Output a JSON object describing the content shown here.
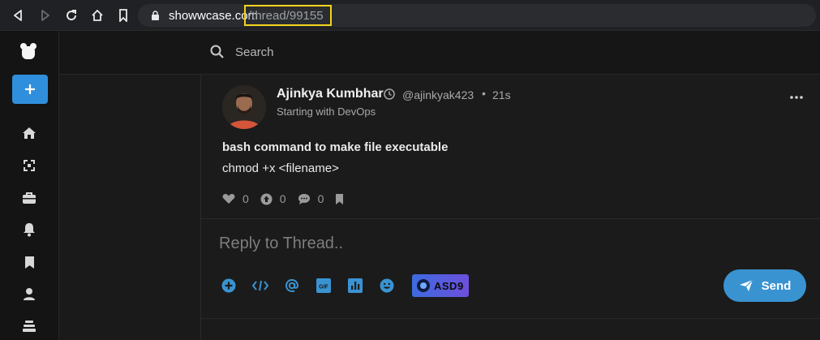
{
  "browser": {
    "url_host": "showwcase.com",
    "url_path": "/thread/99155"
  },
  "search": {
    "placeholder": "Search"
  },
  "post": {
    "author_name": "Ajinkya Kumbhar",
    "handle": "@ajinkyak423",
    "separator": "•",
    "time": "21s",
    "subtitle": "Starting with DevOps",
    "title": "bash command to make file executable",
    "body": "chmod +x <filename>",
    "likes": "0",
    "upvotes": "0",
    "comments": "0"
  },
  "reply": {
    "placeholder": "Reply to Thread..",
    "badge_label": "ASD9",
    "send_label": "Send"
  },
  "colors": {
    "accent": "#2f8fdc",
    "highlight_box": "#f2d31b",
    "send_button": "#3a93d1"
  }
}
